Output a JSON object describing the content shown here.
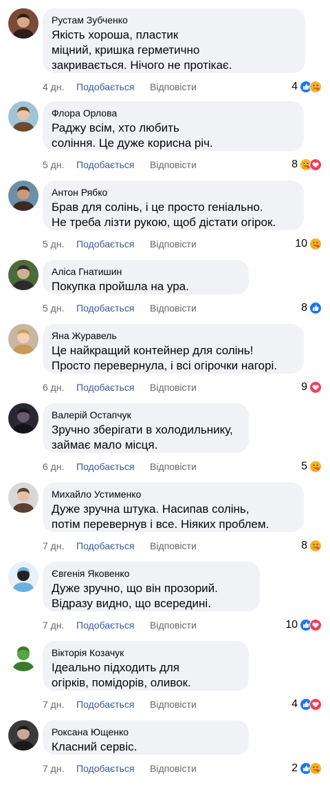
{
  "ui": {
    "like_label": "Подобається",
    "reply_label": "Відповісти"
  },
  "colors": {
    "bubble": "#f0f2f5",
    "link": "#385898",
    "meta": "#65676b",
    "like_blue": "#1877f2",
    "love_red": "#f33e58",
    "care_yellow": "#f7b125"
  },
  "comments": [
    {
      "author": "Рустам Зубченко",
      "text": "Якість хороша, пластик\nміцний, кришка герметично\nзакривається. Нічого не протікає.",
      "time": "4 дн.",
      "count": "4",
      "reactions": [
        "like-icon",
        "care-icon"
      ]
    },
    {
      "author": "Флора Орлова",
      "text": "Раджу всім, хто любить\nсоління. Це дуже корисна річ.",
      "time": "5 дн.",
      "count": "8",
      "reactions": [
        "care-icon",
        "love-icon"
      ]
    },
    {
      "author": "Антон Рябко",
      "text": "Брав для солінь, і це просто геніально.\nНе треба лізти рукою, щоб дістати огірок.",
      "time": "5 дн.",
      "count": "10",
      "reactions": [
        "care-icon"
      ]
    },
    {
      "author": "Аліса Гнатишин",
      "text": "Покупка пройшла на ура.",
      "time": "5 дн.",
      "count": "8",
      "reactions": [
        "like-icon"
      ]
    },
    {
      "author": "Яна Журавель",
      "text": "Це найкращий контейнер для солінь!\nПросто перевернула, і всі огірочки нагорі.",
      "time": "6 дн.",
      "count": "9",
      "reactions": [
        "love-icon"
      ]
    },
    {
      "author": "Валерій Остапчук",
      "text": "Зручно зберігати в холодильнику,\nзаймає мало місця.",
      "time": "6 дн.",
      "count": "5",
      "reactions": [
        "care-icon"
      ]
    },
    {
      "author": "Михайло Устименко",
      "text": "Дуже зручна штука. Насипав солінь,\nпотім перевернув і все. Ніяких проблем.",
      "time": "7 дн.",
      "count": "8",
      "reactions": [
        "care-icon"
      ]
    },
    {
      "author": "Євгенія Яковенко",
      "text": "Дуже зручно, що він прозорий.\nВідразу видно, що всередині.",
      "time": "7 дн.",
      "count": "10",
      "reactions": [
        "like-icon",
        "love-icon"
      ]
    },
    {
      "author": "Вікторія Козачук",
      "text": "Ідеально підходить для\nогірків, помідорів, оливок.",
      "time": "7 дн.",
      "count": "4",
      "reactions": [
        "like-icon",
        "love-icon"
      ]
    },
    {
      "author": "Роксана Ющенко",
      "text": "Класний сервіс.",
      "time": "7 дн.",
      "count": "2",
      "reactions": [
        "like-icon",
        "care-icon"
      ]
    }
  ]
}
